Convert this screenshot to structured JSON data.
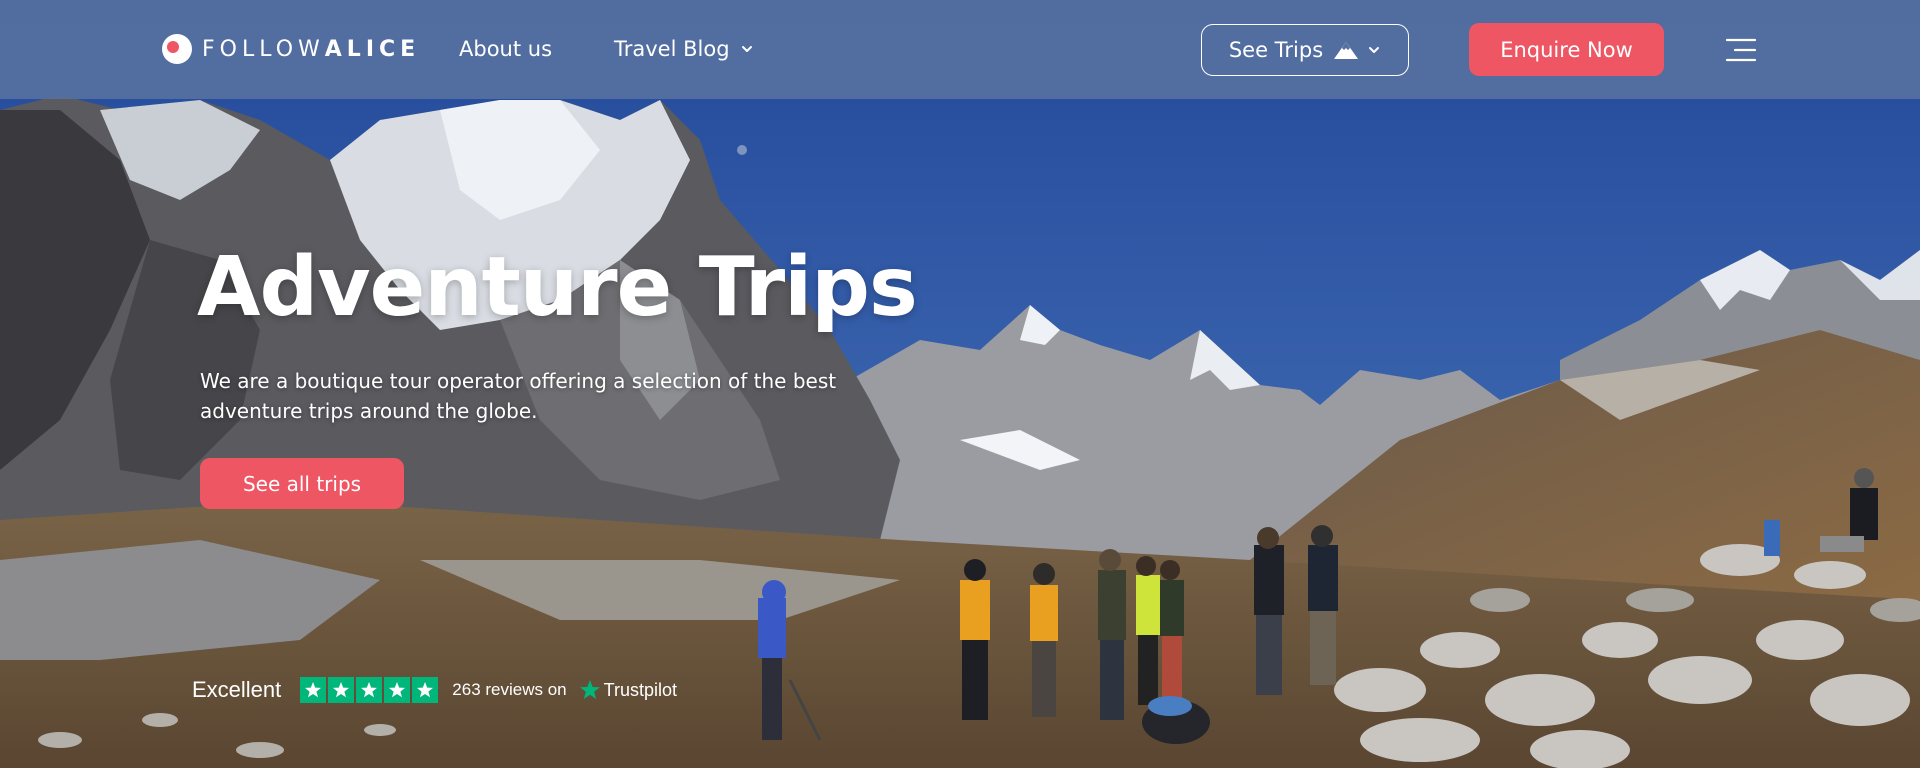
{
  "header": {
    "logo_text_light": "FOLLOW",
    "logo_text_bold": "ALICE",
    "nav": {
      "about": "About us",
      "blog": "Travel Blog"
    },
    "see_trips": "See Trips",
    "enquire": "Enquire Now",
    "menu_icon": "hamburger-icon"
  },
  "hero": {
    "title": "Adventure Trips",
    "subtitle": "We are a boutique tour operator offering a selection of the best adventure trips around the globe.",
    "cta": "See all trips"
  },
  "trustpilot": {
    "rating_word": "Excellent",
    "stars": 5,
    "reviews": "263 reviews on",
    "brand": "Trustpilot"
  },
  "colors": {
    "accent": "#ef5664",
    "header_bg": "#5670a0",
    "trustpilot_green": "#00b67a",
    "sky": "#2f5a9e"
  }
}
